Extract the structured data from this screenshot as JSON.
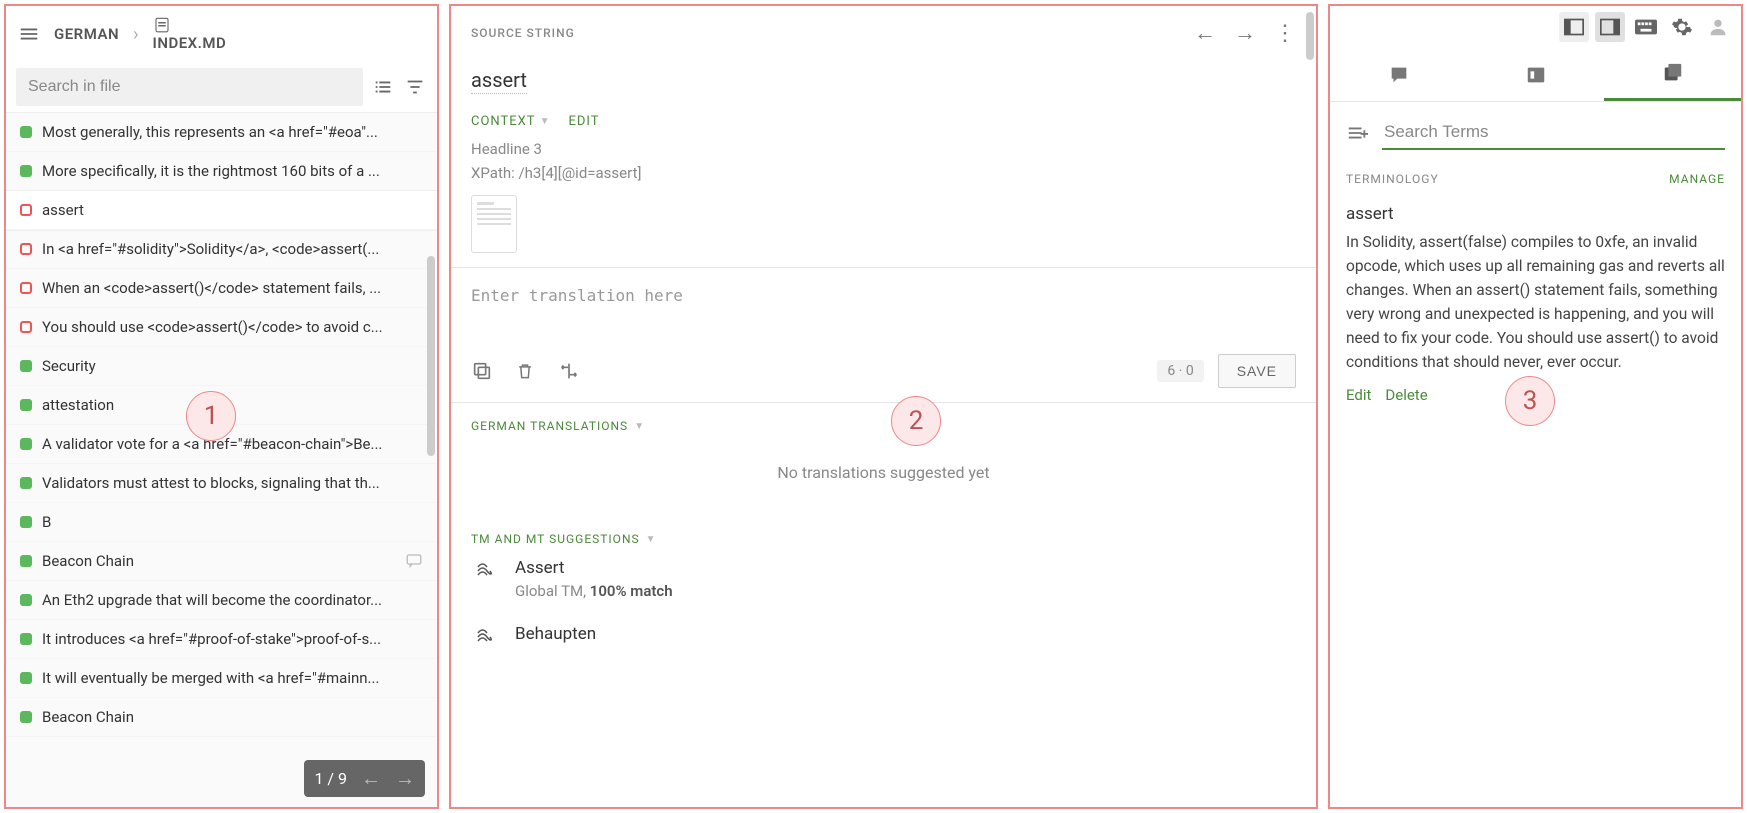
{
  "colors": {
    "accent": "#4a8a3a",
    "annotation": "#e88"
  },
  "annotations": {
    "a1": "1",
    "a2": "2",
    "a3": "3"
  },
  "left": {
    "breadcrumb_lang": "GERMAN",
    "breadcrumb_file": "INDEX.MD",
    "search_placeholder": "Search in file",
    "pager_text": "1 / 9",
    "items": [
      {
        "status": "green",
        "label": "Most generally, this represents an <a href=\"#eoa\"..."
      },
      {
        "status": "green",
        "label": "More specifically, it is the rightmost 160 bits of a ..."
      },
      {
        "status": "red",
        "label": "assert",
        "selected": true
      },
      {
        "status": "red",
        "label": "In <a href=\"#solidity\">Solidity</a>, <code>assert(..."
      },
      {
        "status": "red",
        "label": "When an <code>assert()</code> statement fails, ..."
      },
      {
        "status": "red",
        "label": "You should use <code>assert()</code> to avoid c..."
      },
      {
        "status": "green",
        "label": "Security"
      },
      {
        "status": "green",
        "label": "attestation"
      },
      {
        "status": "green",
        "label": "A validator vote for a <a href=\"#beacon-chain\">Be..."
      },
      {
        "status": "green",
        "label": "Validators must attest to blocks, signaling that th..."
      },
      {
        "status": "green",
        "label": "B"
      },
      {
        "status": "green",
        "label": "Beacon Chain",
        "has_comment_icon": true
      },
      {
        "status": "green",
        "label": "An Eth2 upgrade that will become the coordinator..."
      },
      {
        "status": "green",
        "label": "It introduces <a href=\"#proof-of-stake\">proof-of-s..."
      },
      {
        "status": "green",
        "label": "It will eventually be merged with <a href=\"#mainn..."
      },
      {
        "status": "green",
        "label": "Beacon Chain"
      }
    ]
  },
  "center": {
    "source_section": "SOURCE STRING",
    "source_string": "assert",
    "context_label": "CONTEXT",
    "edit_label": "EDIT",
    "context_line1": "Headline 3",
    "context_line2": "XPath: /h3[4][@id=assert]",
    "translation_placeholder": "Enter translation here",
    "char_count": "6 · 0",
    "save_label": "SAVE",
    "german_translations_label": "GERMAN TRANSLATIONS",
    "no_translations_text": "No translations suggested yet",
    "tm_label": "TM AND MT SUGGESTIONS",
    "tm_items": [
      {
        "text": "Assert",
        "sub_prefix": "Global TM, ",
        "sub_bold": "100% match"
      },
      {
        "text": "Behaupten",
        "sub_prefix": "",
        "sub_bold": ""
      }
    ],
    "icons": {
      "copy": "copy-source-icon",
      "trash": "clear-icon",
      "transform": "transform-icon"
    }
  },
  "right": {
    "search_placeholder": "Search Terms",
    "terminology_label": "TERMINOLOGY",
    "manage_label": "MANAGE",
    "term_title": "assert",
    "term_def": "In Solidity, assert(false) compiles to 0xfe, an invalid opcode, which uses up all remaining gas and reverts all changes. When an assert() statement fails, something very wrong and unexpected is happening, and you will need to fix your code. You should use assert() to avoid conditions that should never, ever occur.",
    "edit_label": "Edit",
    "delete_label": "Delete"
  }
}
